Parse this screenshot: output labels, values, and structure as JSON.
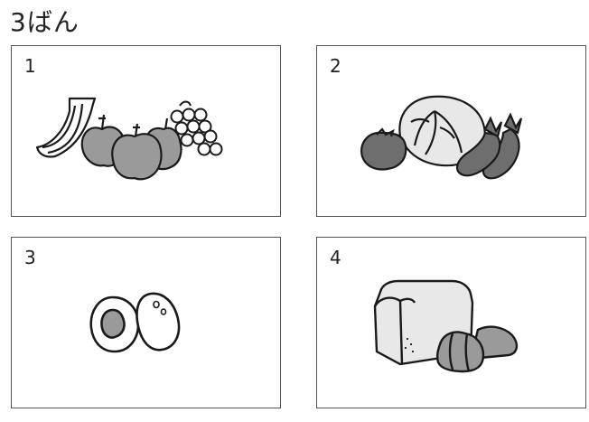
{
  "title": "3ばん",
  "panels": [
    {
      "number": "1",
      "icon": "fruits-icon"
    },
    {
      "number": "2",
      "icon": "vegetables-icon"
    },
    {
      "number": "3",
      "icon": "boiled-egg-icon"
    },
    {
      "number": "4",
      "icon": "bread-icon"
    }
  ],
  "colors": {
    "line": "#1a1a1a",
    "fill_gray": "#9a9a9a",
    "fill_dark": "#6e6e6e",
    "fill_light": "#e8e8e8"
  }
}
